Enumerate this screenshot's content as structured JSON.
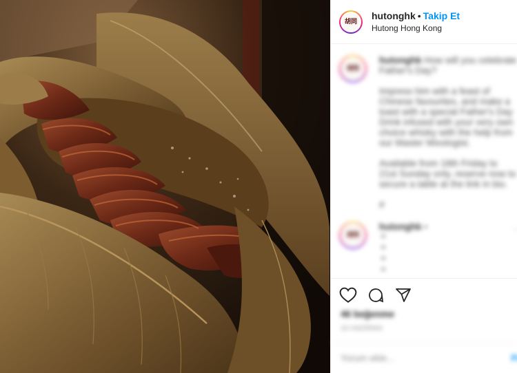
{
  "post": {
    "username": "hutonghk",
    "follow_label": "Takip Et",
    "location": "Hutong Hong Kong",
    "avatar_text": "胡同",
    "photo_subject": "slow-cooked beef wrapped in lotus leaf"
  },
  "caption": {
    "username": "hutonghk",
    "lead": "How will you celebrate Father's Day?",
    "paragraphs": [
      "Impress him with a feast of Chinese favourites, and make a toast with a special Father's Day Drink infused with your very own choice whisky with the help from our Master Mixologist.",
      "Available from 18th Friday to 21st Sunday only, reserve now to secure a table at the link in bio.",
      "#"
    ]
  },
  "reply": {
    "username": "hutonghk",
    "more": "•"
  },
  "actions": {
    "likes": "46 beğenme",
    "time": "16 HAZİRAN",
    "add_comment_placeholder": "Yorum ekle...",
    "post_label": "Pa"
  },
  "icons": [
    "heart-icon",
    "comment-icon",
    "share-icon"
  ]
}
